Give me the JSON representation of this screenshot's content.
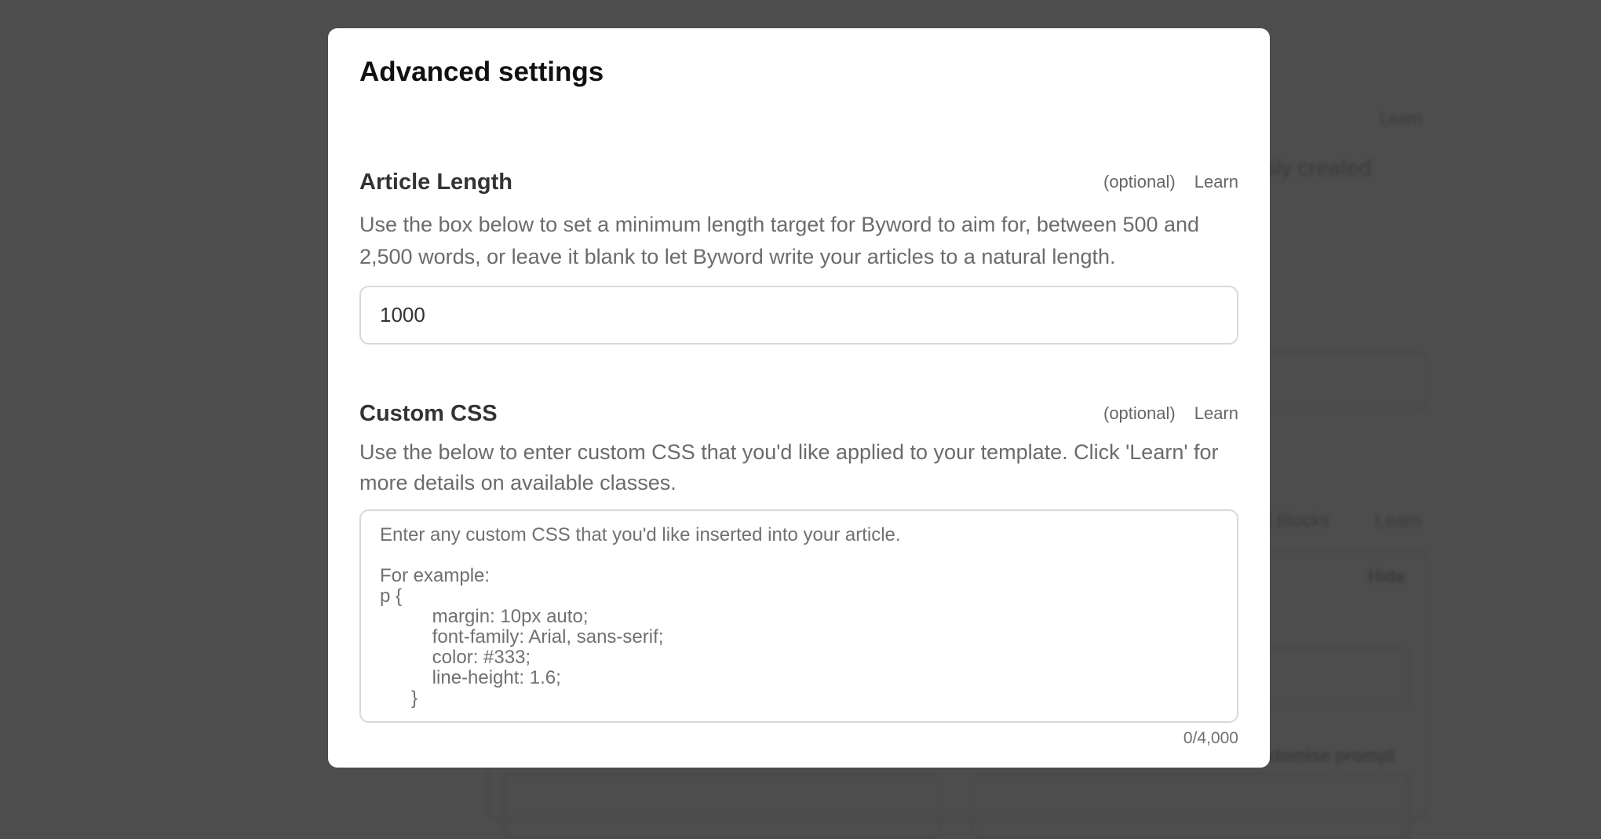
{
  "background": {
    "learn_1": "Learn",
    "partial_text_1": "sly created",
    "partial_blocks": "ll Blocks",
    "learn_2": "Learn",
    "hide": "Hide",
    "partial_prompt": "stomise prompt"
  },
  "modal": {
    "title": "Advanced settings",
    "article_length": {
      "heading": "Article Length",
      "optional": "(optional)",
      "learn": "Learn",
      "description": "Use the box below to set a minimum length target for Byword to aim for, between 500 and 2,500 words, or leave it blank to let Byword write your articles to a natural length.",
      "value": "1000"
    },
    "custom_css": {
      "heading": "Custom CSS",
      "optional": "(optional)",
      "learn": "Learn",
      "description": "Use the below to enter custom CSS that you'd like applied to your template. Click 'Learn' for more details on available classes.",
      "placeholder": "Enter any custom CSS that you'd like inserted into your article.\n\nFor example:\np {\n          margin: 10px auto;\n          font-family: Arial, sans-serif;\n          color: #333;\n          line-height: 1.6;\n      }",
      "counter": "0/4,000"
    }
  }
}
